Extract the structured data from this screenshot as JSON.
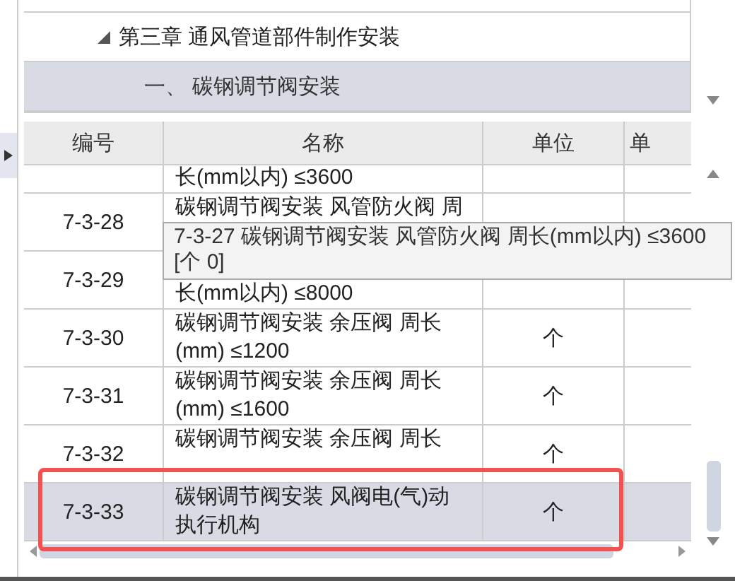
{
  "tree": [
    {
      "label": "第三章 通风管道部件制作安装",
      "expanded": true,
      "selected": false,
      "children": [
        {
          "label": "一、 碳钢调节阀安装",
          "selected": true
        }
      ]
    }
  ],
  "table": {
    "columns": [
      "编号",
      "名称",
      "单位",
      "单"
    ],
    "rows": [
      {
        "name_bottom": "长(mm以内) ≤3600",
        "selected": false
      },
      {
        "id": "7-3-28",
        "name_top": "碳钢调节阀安装 风管防火阀 周",
        "selected": false
      },
      {
        "id": "7-3-29",
        "name_bottom": "长(mm以内) ≤8000",
        "selected": false
      },
      {
        "id": "7-3-30",
        "name_top": "碳钢调节阀安装 余压阀 周长",
        "name_bottom": "(mm) ≤1200",
        "unit": "个",
        "selected": false
      },
      {
        "id": "7-3-31",
        "name_top": "碳钢调节阀安装 余压阀 周长",
        "name_bottom": "(mm) ≤1600",
        "unit": "个",
        "selected": false
      },
      {
        "id": "7-3-32",
        "name_top": "碳钢调节阀安装 余压阀 周长",
        "unit": "个",
        "selected": false
      },
      {
        "id": "7-3-33",
        "name_top": "碳钢调节阀安装 风阀电(气)动",
        "name_bottom": "执行机构",
        "unit": "个",
        "selected": true,
        "highlighted": true
      }
    ]
  },
  "tooltip": {
    "lines": [
      "7-3-27  碳钢调节阀安装 风管防火阀 周长(mm以内) ≤3600",
      "[个 0]"
    ]
  }
}
